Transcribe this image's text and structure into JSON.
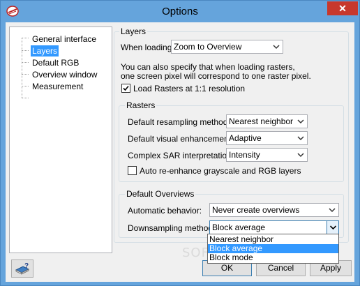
{
  "window": {
    "title": "Options",
    "close_label": "✕"
  },
  "tree": {
    "items": [
      {
        "label": "General interface",
        "selected": false
      },
      {
        "label": "Layers",
        "selected": true
      },
      {
        "label": "Default RGB",
        "selected": false
      },
      {
        "label": "Overview window",
        "selected": false
      },
      {
        "label": "Measurement",
        "selected": false
      }
    ]
  },
  "layers_group": {
    "title": "Layers",
    "when_loading_label": "When loading",
    "when_loading_value": "Zoom to Overview",
    "info_line1": "You can also specify that when loading rasters,",
    "info_line2": "one screen pixel will correspond to one raster pixel.",
    "load_rasters_label": "Load Rasters at 1:1 resolution",
    "load_rasters_checked": true
  },
  "rasters_group": {
    "title": "Rasters",
    "resampling_label": "Default resampling method:",
    "resampling_value": "Nearest neighbor",
    "enhancement_label": "Default visual enhancement:",
    "enhancement_value": "Adaptive",
    "sar_label": "Complex SAR interpretation:",
    "sar_value": "Intensity",
    "auto_enhance_label": "Auto re-enhance grayscale and RGB layers",
    "auto_enhance_checked": false
  },
  "overviews_group": {
    "title": "Default Overviews",
    "behavior_label": "Automatic behavior:",
    "behavior_value": "Never create overviews",
    "downsampling_label": "Downsampling method:",
    "downsampling_value": "Block average",
    "downsampling_options": [
      "Nearest neighbor",
      "Block average",
      "Block mode"
    ],
    "downsampling_highlighted": "Block average"
  },
  "buttons": {
    "ok": "OK",
    "cancel": "Cancel",
    "apply": "Apply"
  },
  "watermark": "SOFTPEDIA",
  "colors": {
    "titlebar": "#65a4dc",
    "selection": "#3399ff",
    "close": "#c7382c"
  }
}
